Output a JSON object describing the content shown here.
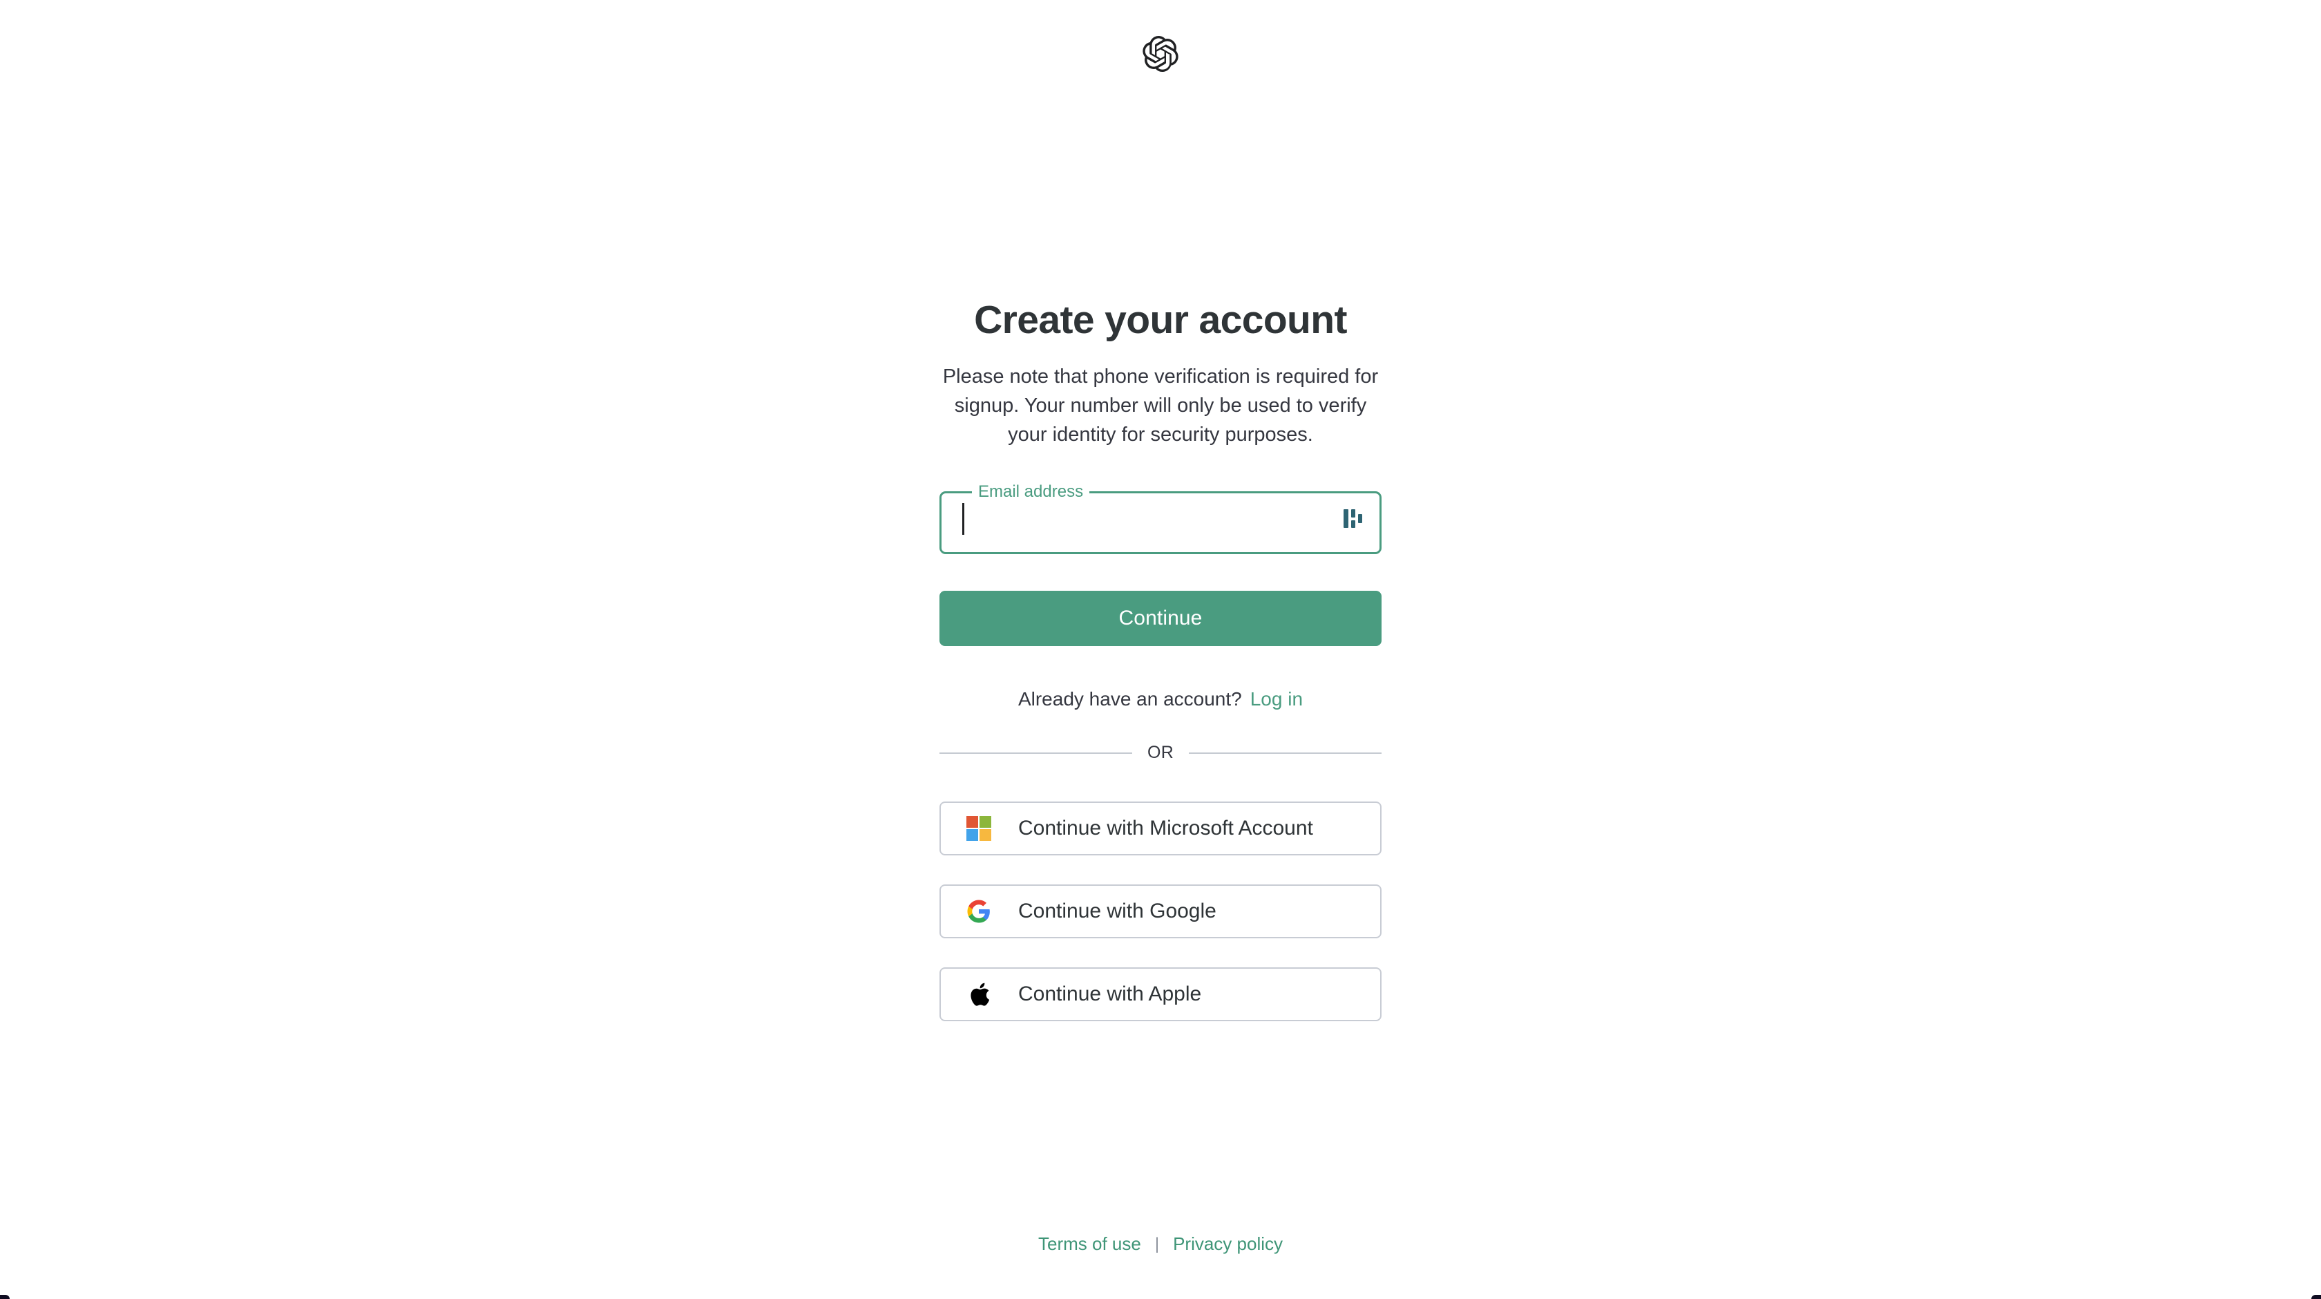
{
  "brand": {
    "logo_icon": "openai-logo",
    "logo_color": "#202123"
  },
  "heading": {
    "title": "Create your account",
    "subtitle": "Please note that phone verification is required for signup. Your number will only be used to verify your identity for security purposes."
  },
  "form": {
    "email": {
      "label": "Email address",
      "value": "",
      "placeholder": "",
      "focused": true,
      "accent_color": "#4a9c80",
      "password_manager_icon": "bitwarden-autofill-icon",
      "password_manager_icon_color": "#2e6473"
    },
    "submit": {
      "label": "Continue",
      "background_color": "#4a9c80",
      "text_color": "#ffffff"
    }
  },
  "account_prompt": {
    "text": "Already have an account?",
    "link_label": "Log in",
    "link_color": "#4a9c80"
  },
  "divider": {
    "label": "OR",
    "rule_color": "#c5cad1"
  },
  "social_buttons": [
    {
      "id": "microsoft",
      "label": "Continue with Microsoft Account",
      "icon": "microsoft-logo-icon",
      "colors": {
        "top_left": "#e05634",
        "top_right": "#8cb63c",
        "bottom_left": "#42a3ea",
        "bottom_right": "#f7b83f"
      }
    },
    {
      "id": "google",
      "label": "Continue with Google",
      "icon": "google-logo-icon",
      "colors": {
        "blue": "#4285f4",
        "green": "#34a853",
        "yellow": "#fbbc05",
        "red": "#ea4335"
      }
    },
    {
      "id": "apple",
      "label": "Continue with Apple",
      "icon": "apple-logo-icon",
      "colors": {
        "black": "#000000"
      }
    }
  ],
  "footer": {
    "terms_label": "Terms of use",
    "separator": "|",
    "privacy_label": "Privacy policy",
    "link_color": "#3f9577"
  }
}
